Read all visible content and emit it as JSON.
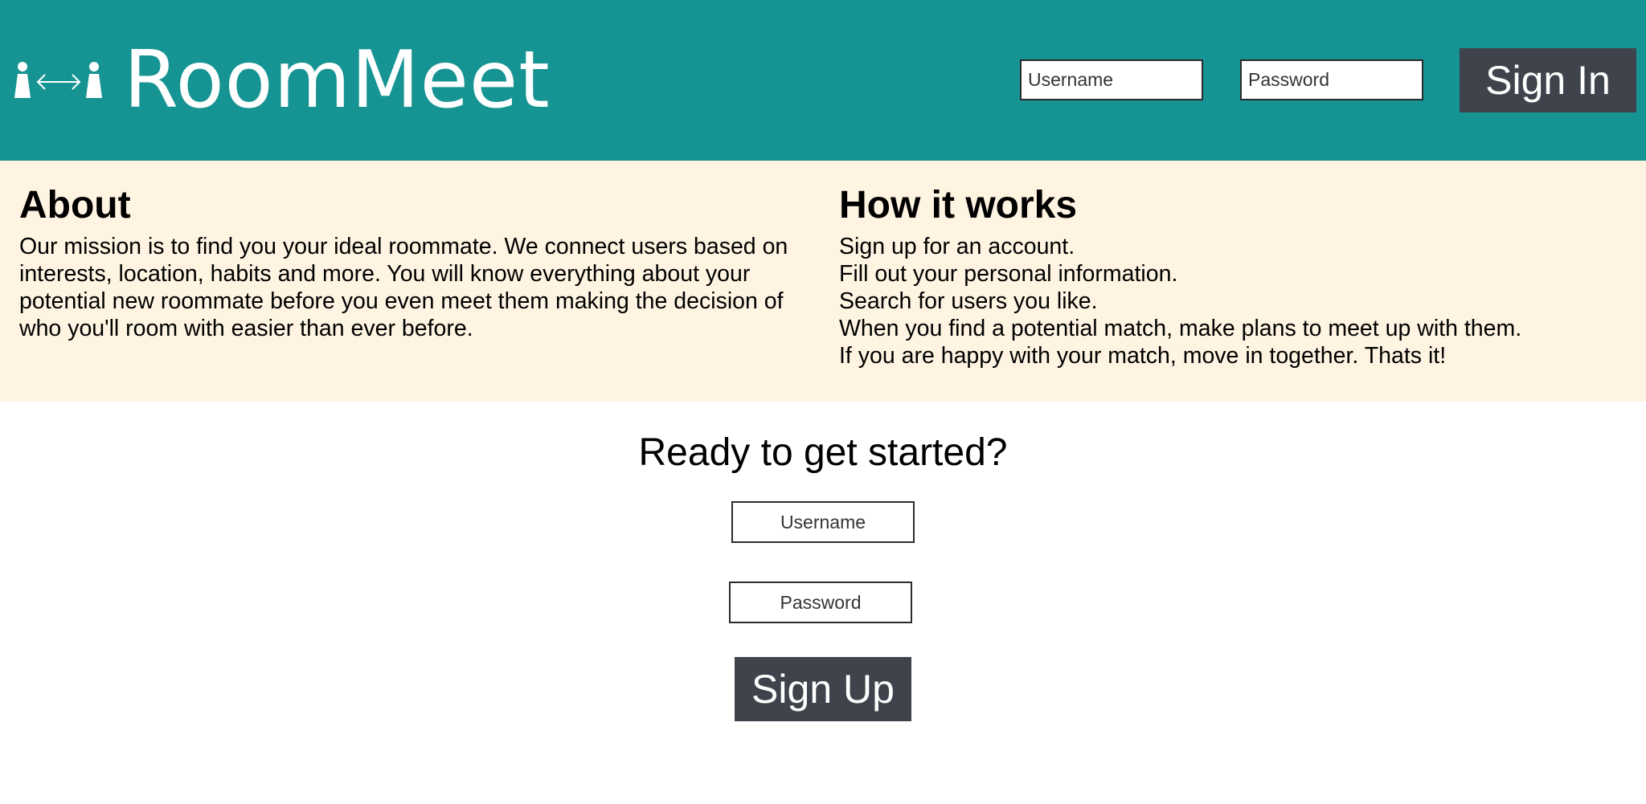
{
  "header": {
    "brand": "RoomMeet",
    "logo_icon": "roommates-connect-icon",
    "username_placeholder": "Username",
    "password_placeholder": "Password",
    "signin_label": "Sign In"
  },
  "about": {
    "title": "About",
    "text": "Our mission is to find you your ideal roommate. We connect users based on interests, location, habits and more. You will know everything about your potential new roommate before you even meet them making the decision of who you'll room with easier than ever before."
  },
  "how": {
    "title": "How it works",
    "steps": [
      "Sign up for an account.",
      "Fill out your personal information.",
      "Search for users you like.",
      "When you find a potential match, make plans to meet up with them.",
      "If you are happy with your match, move in together. Thats it!"
    ]
  },
  "signup": {
    "title": "Ready to get started?",
    "username_placeholder": "Username",
    "password_placeholder": "Password",
    "signup_label": "Sign Up"
  },
  "colors": {
    "header_bg": "#169493",
    "info_bg": "#fff4e2",
    "button_bg": "#3f444c"
  }
}
